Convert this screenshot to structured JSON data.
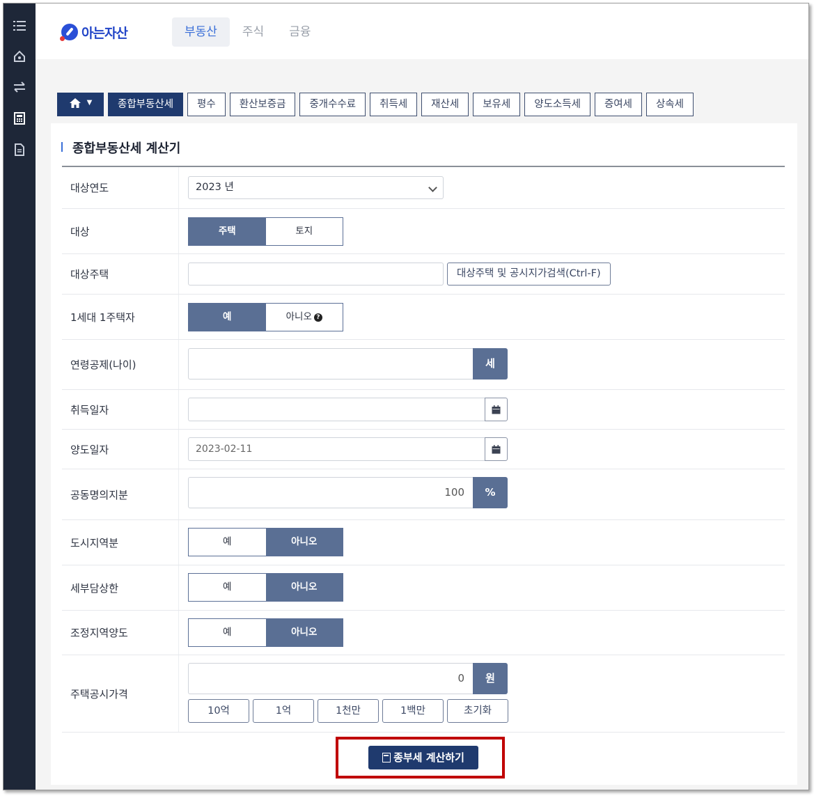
{
  "brand": {
    "name": "아는자산"
  },
  "main_tabs": [
    {
      "label": "부동산",
      "active": true
    },
    {
      "label": "주식",
      "active": false
    },
    {
      "label": "금융",
      "active": false
    }
  ],
  "calc_tabs": [
    {
      "label": "종합부동산세",
      "active": true
    },
    {
      "label": "평수"
    },
    {
      "label": "환산보증금"
    },
    {
      "label": "중개수수료"
    },
    {
      "label": "취득세"
    },
    {
      "label": "재산세"
    },
    {
      "label": "보유세"
    },
    {
      "label": "양도소득세"
    },
    {
      "label": "증여세"
    },
    {
      "label": "상속세"
    }
  ],
  "form": {
    "title": "종합부동산세 계산기",
    "year": {
      "label": "대상연도",
      "value": "2023 년"
    },
    "target": {
      "label": "대상",
      "options": [
        "주택",
        "토지"
      ],
      "selected": "주택"
    },
    "house": {
      "label": "대상주택",
      "value": "",
      "search_button": "대상주택 및 공시지가검색(Ctrl-F)"
    },
    "single_owner": {
      "label": "1세대 1주택자",
      "options": [
        "예",
        "아니오"
      ],
      "selected": "예"
    },
    "age": {
      "label": "연령공제(나이)",
      "value": "",
      "unit": "세"
    },
    "acquired": {
      "label": "취득일자",
      "value": ""
    },
    "transfer": {
      "label": "양도일자",
      "value": "2023-02-11"
    },
    "share": {
      "label": "공동명의지분",
      "value": "100",
      "unit": "%"
    },
    "urban": {
      "label": "도시지역분",
      "options": [
        "예",
        "아니오"
      ],
      "selected": "아니오"
    },
    "tax_cap": {
      "label": "세부담상한",
      "options": [
        "예",
        "아니오"
      ],
      "selected": "아니오"
    },
    "adjusted": {
      "label": "조정지역양도",
      "options": [
        "예",
        "아니오"
      ],
      "selected": "아니오"
    },
    "price": {
      "label": "주택공시가격",
      "value": "0",
      "unit": "원",
      "quick": [
        "10억",
        "1억",
        "1천만",
        "1백만",
        "초기화"
      ]
    },
    "submit": "종부세 계산하기"
  },
  "colors": {
    "navy": "#1f3a6e",
    "slate": "#5a6f94",
    "highlight": "#c00000"
  },
  "sidebar_icons": [
    "menu-icon",
    "home-icon",
    "transfer-icon",
    "calculator-icon",
    "document-icon"
  ]
}
